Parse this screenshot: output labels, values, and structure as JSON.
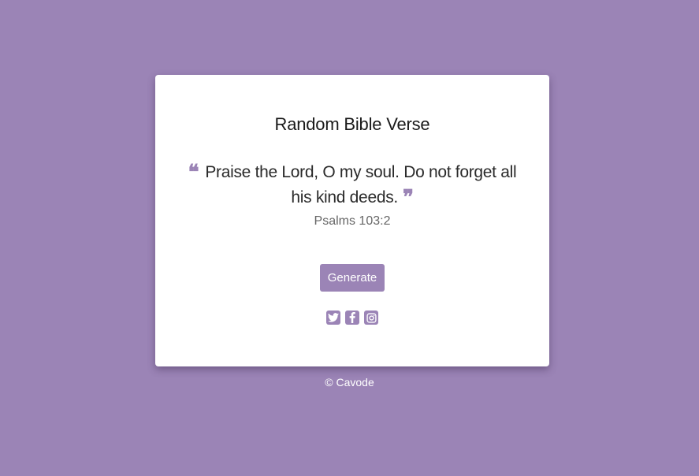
{
  "card": {
    "title": "Random Bible Verse",
    "quote": {
      "open_mark": "❝",
      "text": "Praise the Lord, O my soul. Do not forget all his kind deeds.",
      "close_mark": "❞"
    },
    "reference": "Psalms 103:2",
    "generate_label": "Generate",
    "socials": [
      {
        "name": "twitter",
        "icon": "twitter-icon"
      },
      {
        "name": "facebook",
        "icon": "facebook-icon"
      },
      {
        "name": "instagram",
        "icon": "instagram-icon"
      }
    ]
  },
  "footer": {
    "text": "© Cavode"
  },
  "colors": {
    "background": "#9b84b6",
    "accent": "#9b84b6",
    "card": "#ffffff"
  }
}
